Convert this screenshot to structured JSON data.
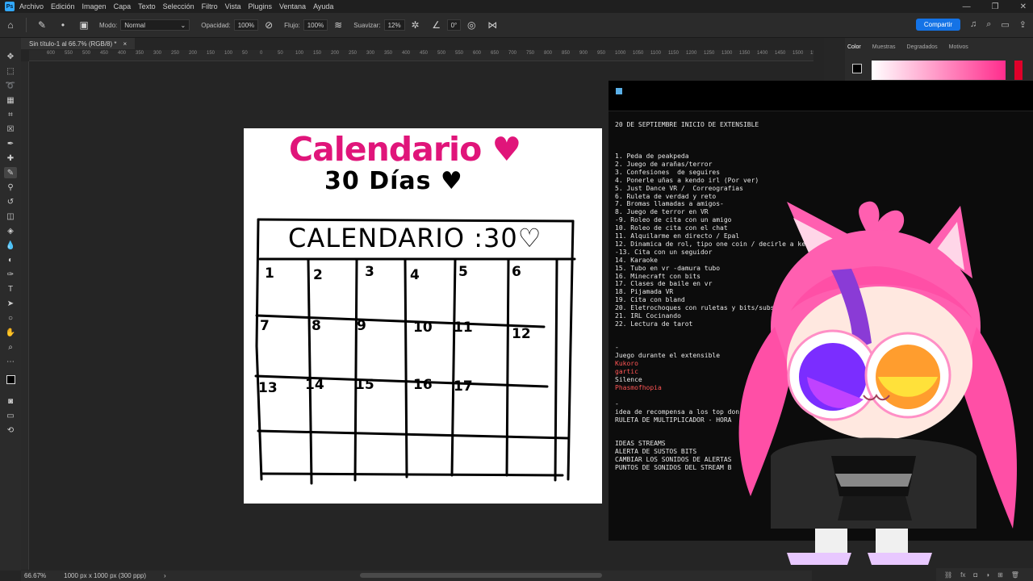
{
  "menubar": {
    "logo": "Ps",
    "items": [
      "Archivo",
      "Edición",
      "Imagen",
      "Capa",
      "Texto",
      "Selección",
      "Filtro",
      "Vista",
      "Plugins",
      "Ventana",
      "Ayuda"
    ],
    "controls": [
      "—",
      "❐",
      "✕"
    ]
  },
  "options": {
    "mode_label": "Modo:",
    "mode_value": "Normal",
    "opacity_label": "Opacidad:",
    "opacity_value": "100%",
    "flow_label": "Flujo:",
    "flow_value": "100%",
    "smooth_label": "Suavizar:",
    "smooth_value": "12%",
    "angle_value": "0°",
    "share_label": "Compartir"
  },
  "document": {
    "tab_title": "Sin título-1 al 66.7% (RGB/8) *",
    "close": "×"
  },
  "ruler": {
    "ticks": [
      "600",
      "550",
      "500",
      "450",
      "400",
      "350",
      "300",
      "250",
      "200",
      "150",
      "100",
      "50",
      "0",
      "50",
      "100",
      "150",
      "200",
      "250",
      "300",
      "350",
      "400",
      "450",
      "500",
      "550",
      "600",
      "650",
      "700",
      "750",
      "800",
      "850",
      "900",
      "950",
      "1000",
      "1050",
      "1100",
      "1150",
      "1200",
      "1250",
      "1300",
      "1350",
      "1400",
      "1450",
      "1500",
      "1550"
    ]
  },
  "canvas": {
    "title": "Calendario ♥",
    "subtitle": "30 Días ♥",
    "grid_header": "CALENDARIO :30♡",
    "day_numbers": [
      "1",
      "2",
      "3",
      "4",
      "5",
      "6",
      "7",
      "8",
      "9",
      "10",
      "11",
      "12",
      "13",
      "14",
      "15",
      "16",
      "17"
    ]
  },
  "status": {
    "zoom": "66.67%",
    "doc_info": "1000 px x 1000 px (300 ppp)",
    "arrow": "›"
  },
  "color_panel": {
    "tabs": [
      "Color",
      "Muestras",
      "Degradados",
      "Motivos"
    ]
  },
  "terminal": {
    "header_line": "20 DE SEPTIEMBRE INICIO DE EXTENSIBLE",
    "items": [
      "1. Peda de peakpeda",
      "2. Juego de arañas/terror",
      "3. Confesiones  de seguires",
      "4. Ponerle uñas a kendo irl (Por ver)",
      "5. Just Dance VR /  Correografias",
      "6. Ruleta de verdad y reto",
      "7. Bromas llamadas a amigos-",
      "8. Juego de terror en VR",
      "-9. Roleo de cita con un amigo",
      "10. Roleo de cita con el chat",
      "11. Alquilarme en directo / Epal",
      "12. Dinamica de rol, tipo one coin / decirle a ke",
      "-13. Cita con un seguidor",
      "14. Karaoke",
      "15. Tubo en vr -damura tubo",
      "16. Minecraft con bits",
      "17. Clases de baile en vr",
      "18. Pijamada VR",
      "19. Cita con bland",
      "20. Eletrochoques con ruletas y bits/subs",
      "21. IRL Cocinando",
      "22. Lectura de tarot"
    ],
    "dash1": "-",
    "games_title": "Juego durante el extensible",
    "games": [
      "Kukoro",
      "gartic",
      "Silence",
      "Phasmofhopia"
    ],
    "dash2": "-",
    "reward_line1": "idea de recompensa a los top don",
    "reward_line2": "RULETA DE MULTIPLICADOR - HORA",
    "ideas_title": "IDEAS STREAMS",
    "ideas": [
      "ALERTA DE SUSTOS BITS",
      "CAMBIAR LOS SONIDOS DE ALERTAS",
      "PUNTOS DE SONIDOS DEL STREAM B"
    ]
  },
  "colors": {
    "accent_pink": "#e0157a",
    "share_blue": "#1473e6",
    "avatar_pink": "#ff5fb0"
  }
}
